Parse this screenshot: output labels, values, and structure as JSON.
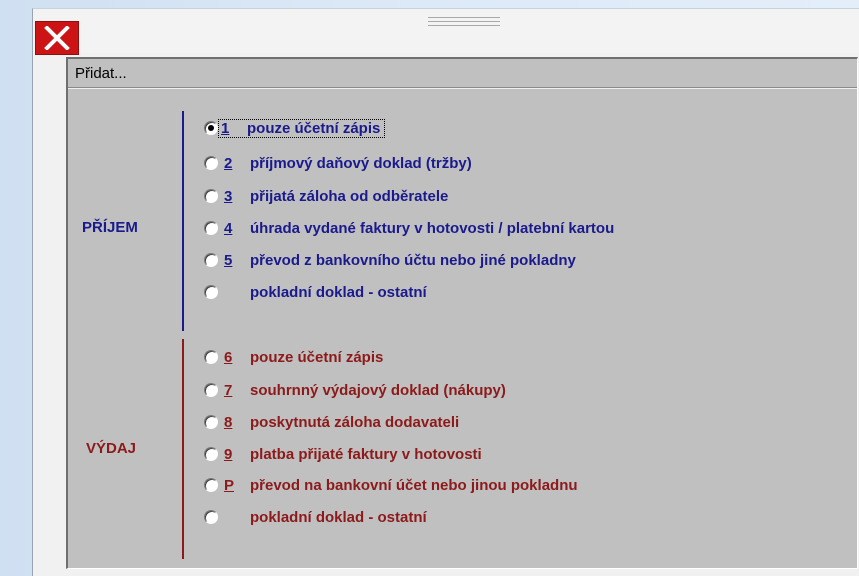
{
  "window": {
    "close_icon": "close-icon",
    "colors": {
      "close_bg": "#cc1414",
      "income": "#1a1a8c",
      "expense": "#8c1a1a",
      "panel": "#c0c0c0"
    }
  },
  "panel": {
    "title": "Přidat..."
  },
  "groups": {
    "income": {
      "label": "PŘÍJEM",
      "options": [
        {
          "key": "1",
          "label": "pouze účetní zápis",
          "selected": true
        },
        {
          "key": "2",
          "label": "příjmový daňový doklad (tržby)",
          "selected": false
        },
        {
          "key": "3",
          "label": "přijatá záloha od odběratele",
          "selected": false
        },
        {
          "key": "4",
          "label": "úhrada vydané faktury v hotovosti / platební kartou",
          "selected": false
        },
        {
          "key": "5",
          "label": "převod z bankovního účtu nebo jiné pokladny",
          "selected": false
        },
        {
          "key": "",
          "label": "pokladní doklad - ostatní",
          "selected": false
        }
      ]
    },
    "expense": {
      "label": "VÝDAJ",
      "options": [
        {
          "key": "6",
          "label": "pouze účetní zápis",
          "selected": false
        },
        {
          "key": "7",
          "label": "souhrnný výdajový doklad (nákupy)",
          "selected": false
        },
        {
          "key": "8",
          "label": "poskytnutá záloha dodavateli",
          "selected": false
        },
        {
          "key": "9",
          "label": "platba přijaté faktury v hotovosti",
          "selected": false
        },
        {
          "key": "P",
          "label": "převod na bankovní účet nebo jinou pokladnu",
          "selected": false
        },
        {
          "key": "",
          "label": "pokladní doklad - ostatní",
          "selected": false
        }
      ]
    }
  }
}
